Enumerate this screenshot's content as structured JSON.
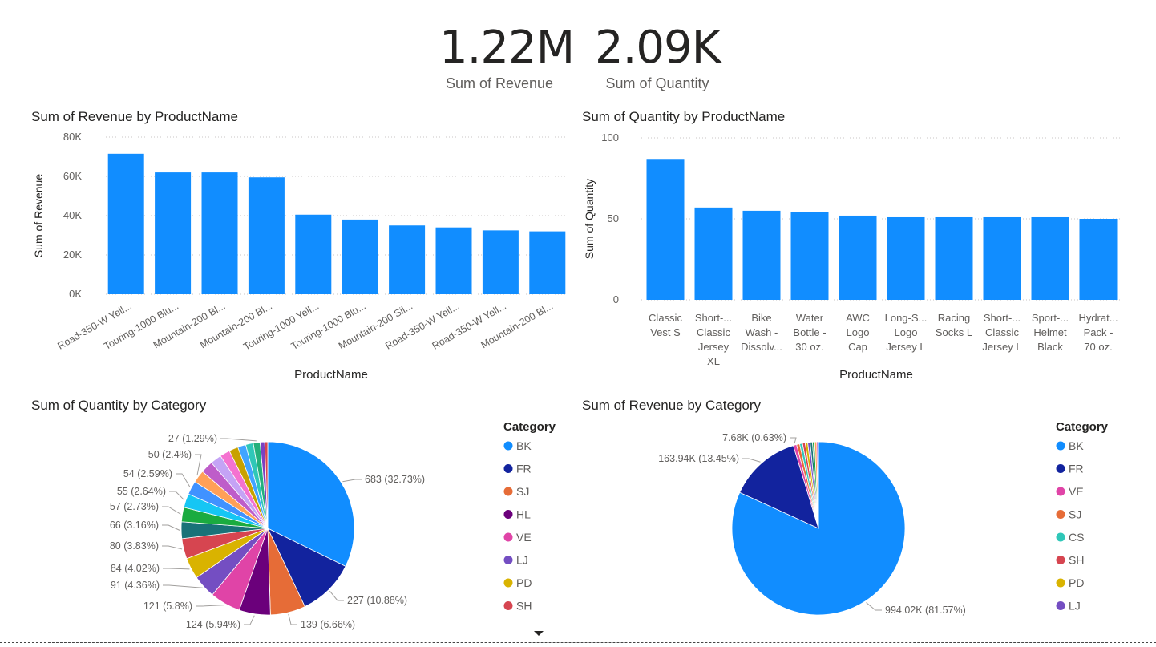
{
  "kpis": [
    {
      "value": "1.22M",
      "label": "Sum of Revenue"
    },
    {
      "value": "2.09K",
      "label": "Sum of Quantity"
    }
  ],
  "chart_data": [
    {
      "type": "bar",
      "title": "Sum of Revenue by ProductName",
      "xlabel": "ProductName",
      "ylabel": "Sum of Revenue",
      "ylim": [
        0,
        80000
      ],
      "yticks": [
        "0K",
        "20K",
        "40K",
        "60K",
        "80K"
      ],
      "color": "#118DFF",
      "categories": [
        "Road-350-W Yell...",
        "Touring-1000 Blu...",
        "Mountain-200 Bl...",
        "Mountain-200 Bl...",
        "Touring-1000 Yell...",
        "Touring-1000 Blu...",
        "Mountain-200 Sil...",
        "Road-350-W Yell...",
        "Road-350-W Yell...",
        "Mountain-200 Bl..."
      ],
      "values": [
        71500,
        62000,
        62000,
        59500,
        40500,
        38000,
        35000,
        34000,
        32500,
        32000
      ]
    },
    {
      "type": "bar",
      "title": "Sum of Quantity by ProductName",
      "xlabel": "ProductName",
      "ylabel": "Sum of Quantity",
      "ylim": [
        0,
        100
      ],
      "yticks": [
        "0",
        "50",
        "100"
      ],
      "color": "#118DFF",
      "categories": [
        [
          "Classic",
          "Vest S"
        ],
        [
          "Short-...",
          "Classic",
          "Jersey",
          "XL"
        ],
        [
          "Bike",
          "Wash -",
          "Dissolv..."
        ],
        [
          "Water",
          "Bottle -",
          "30 oz."
        ],
        [
          "AWC",
          "Logo",
          "Cap"
        ],
        [
          "Long-S...",
          "Logo",
          "Jersey L"
        ],
        [
          "Racing",
          "Socks L"
        ],
        [
          "Short-...",
          "Classic",
          "Jersey L"
        ],
        [
          "Sport-...",
          "Helmet",
          "Black"
        ],
        [
          "Hydrat...",
          "Pack -",
          "70 oz."
        ]
      ],
      "values": [
        87,
        57,
        55,
        54,
        52,
        51,
        51,
        51,
        51,
        50
      ]
    },
    {
      "type": "pie",
      "title": "Sum of Quantity by Category",
      "legend_title": "Category",
      "legend": [
        {
          "name": "BK",
          "color": "#118DFF"
        },
        {
          "name": "FR",
          "color": "#12239E"
        },
        {
          "name": "SJ",
          "color": "#E66C37"
        },
        {
          "name": "HL",
          "color": "#6B007B"
        },
        {
          "name": "VE",
          "color": "#E044A7"
        },
        {
          "name": "LJ",
          "color": "#744EC2"
        },
        {
          "name": "PD",
          "color": "#D9B300"
        },
        {
          "name": "SH",
          "color": "#D64550"
        }
      ],
      "slices": [
        {
          "value": 683,
          "color": "#118DFF",
          "label": "683 (32.73%)"
        },
        {
          "value": 227,
          "color": "#12239E",
          "label": "227 (10.88%)"
        },
        {
          "value": 139,
          "color": "#E66C37",
          "label": "139 (6.66%)"
        },
        {
          "value": 124,
          "color": "#6B007B",
          "label": "124 (5.94%)"
        },
        {
          "value": 121,
          "color": "#E044A7",
          "label": "121 (5.8%)"
        },
        {
          "value": 91,
          "color": "#744EC2",
          "label": "91 (4.36%)"
        },
        {
          "value": 84,
          "color": "#D9B300",
          "label": "84 (4.02%)"
        },
        {
          "value": 80,
          "color": "#D64550",
          "label": "80 (3.83%)"
        },
        {
          "value": 66,
          "color": "#197278",
          "label": "66 (3.16%)"
        },
        {
          "value": 57,
          "color": "#1AAB40",
          "label": "57 (2.73%)"
        },
        {
          "value": 55,
          "color": "#15C6F4",
          "label": "55 (2.64%)"
        },
        {
          "value": 54,
          "color": "#4092FF",
          "label": "54 (2.59%)"
        },
        {
          "value": 50,
          "color": "#FFA058",
          "label": "50 (2.4%)"
        },
        {
          "value": 49,
          "color": "#BE5DC9",
          "label": ""
        },
        {
          "value": 44,
          "color": "#C4A3F5",
          "label": ""
        },
        {
          "value": 40,
          "color": "#F472D0",
          "label": ""
        },
        {
          "value": 36,
          "color": "#C8A100",
          "label": ""
        },
        {
          "value": 32,
          "color": "#41A4FF",
          "label": ""
        },
        {
          "value": 30,
          "color": "#2FC7B8",
          "label": ""
        },
        {
          "value": 27,
          "color": "#24B07B",
          "label": "27 (1.29%)"
        },
        {
          "value": 18,
          "color": "#7B41C2",
          "label": ""
        },
        {
          "value": 12,
          "color": "#D64550",
          "label": ""
        }
      ]
    },
    {
      "type": "pie",
      "title": "Sum of Revenue by Category",
      "legend_title": "Category",
      "legend": [
        {
          "name": "BK",
          "color": "#118DFF"
        },
        {
          "name": "FR",
          "color": "#12239E"
        },
        {
          "name": "VE",
          "color": "#E044A7"
        },
        {
          "name": "SJ",
          "color": "#E66C37"
        },
        {
          "name": "CS",
          "color": "#2FC7B8"
        },
        {
          "name": "SH",
          "color": "#D64550"
        },
        {
          "name": "PD",
          "color": "#D9B300"
        },
        {
          "name": "LJ",
          "color": "#744EC2"
        }
      ],
      "slices": [
        {
          "value": 994020,
          "color": "#118DFF",
          "label": "994.02K (81.57%)"
        },
        {
          "value": 163940,
          "color": "#12239E",
          "label": "163.94K (13.45%)"
        },
        {
          "value": 7680,
          "color": "#E044A7",
          "label": "7.68K (0.63%)"
        },
        {
          "value": 7000,
          "color": "#E66C37",
          "label": ""
        },
        {
          "value": 6500,
          "color": "#2FC7B8",
          "label": ""
        },
        {
          "value": 6000,
          "color": "#D64550",
          "label": ""
        },
        {
          "value": 5800,
          "color": "#D9B300",
          "label": ""
        },
        {
          "value": 5500,
          "color": "#744EC2",
          "label": ""
        },
        {
          "value": 5200,
          "color": "#197278",
          "label": ""
        },
        {
          "value": 5000,
          "color": "#1AAB40",
          "label": ""
        },
        {
          "value": 4500,
          "color": "#FFA058",
          "label": ""
        },
        {
          "value": 4000,
          "color": "#BE5DC9",
          "label": ""
        }
      ]
    }
  ]
}
